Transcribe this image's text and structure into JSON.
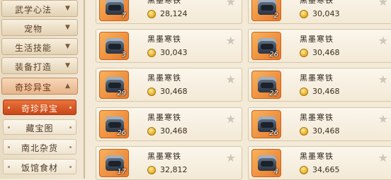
{
  "sidebar": {
    "categories": [
      {
        "label": "武学心法",
        "arrow": "▼"
      },
      {
        "label": "宠物",
        "arrow": "▼"
      },
      {
        "label": "生活技能",
        "arrow": "▼"
      },
      {
        "label": "装备打造",
        "arrow": "▼"
      },
      {
        "label": "奇珍异宝",
        "arrow": "▲"
      }
    ],
    "subitems": [
      {
        "label": "奇珍异宝"
      },
      {
        "label": "藏宝图"
      },
      {
        "label": "南北杂货"
      },
      {
        "label": "饭馆食材"
      }
    ]
  },
  "colors": {
    "active_tab": "#d9572a",
    "icon_bg": "#f0923e",
    "coin": "#e8b52a"
  },
  "items": [
    {
      "name": "黑墨寒铁",
      "count": "7",
      "price": "28,124",
      "icon": "iron-ingot-icon"
    },
    {
      "name": "黑墨寒铁",
      "count": "2",
      "price": "30,043",
      "icon": "iron-ingot-icon"
    },
    {
      "name": "黑墨寒铁",
      "count": "3",
      "price": "30,043",
      "icon": "iron-ingot-icon"
    },
    {
      "name": "黑墨寒铁",
      "count": "26",
      "price": "30,468",
      "icon": "iron-ingot-icon"
    },
    {
      "name": "黑墨寒铁",
      "count": "29",
      "price": "30,468",
      "icon": "iron-ingot-icon"
    },
    {
      "name": "黑墨寒铁",
      "count": "22",
      "price": "30,468",
      "icon": "iron-ingot-icon"
    },
    {
      "name": "黑墨寒铁",
      "count": "26",
      "price": "30,468",
      "icon": "iron-ingot-icon"
    },
    {
      "name": "黑墨寒铁",
      "count": "26",
      "price": "30,468",
      "icon": "iron-ingot-icon"
    },
    {
      "name": "黑墨寒铁",
      "count": "17",
      "price": "32,812",
      "icon": "iron-ingot-icon"
    },
    {
      "name": "黑墨寒铁",
      "count": "4",
      "price": "34,665",
      "icon": "iron-ingot-icon"
    }
  ]
}
